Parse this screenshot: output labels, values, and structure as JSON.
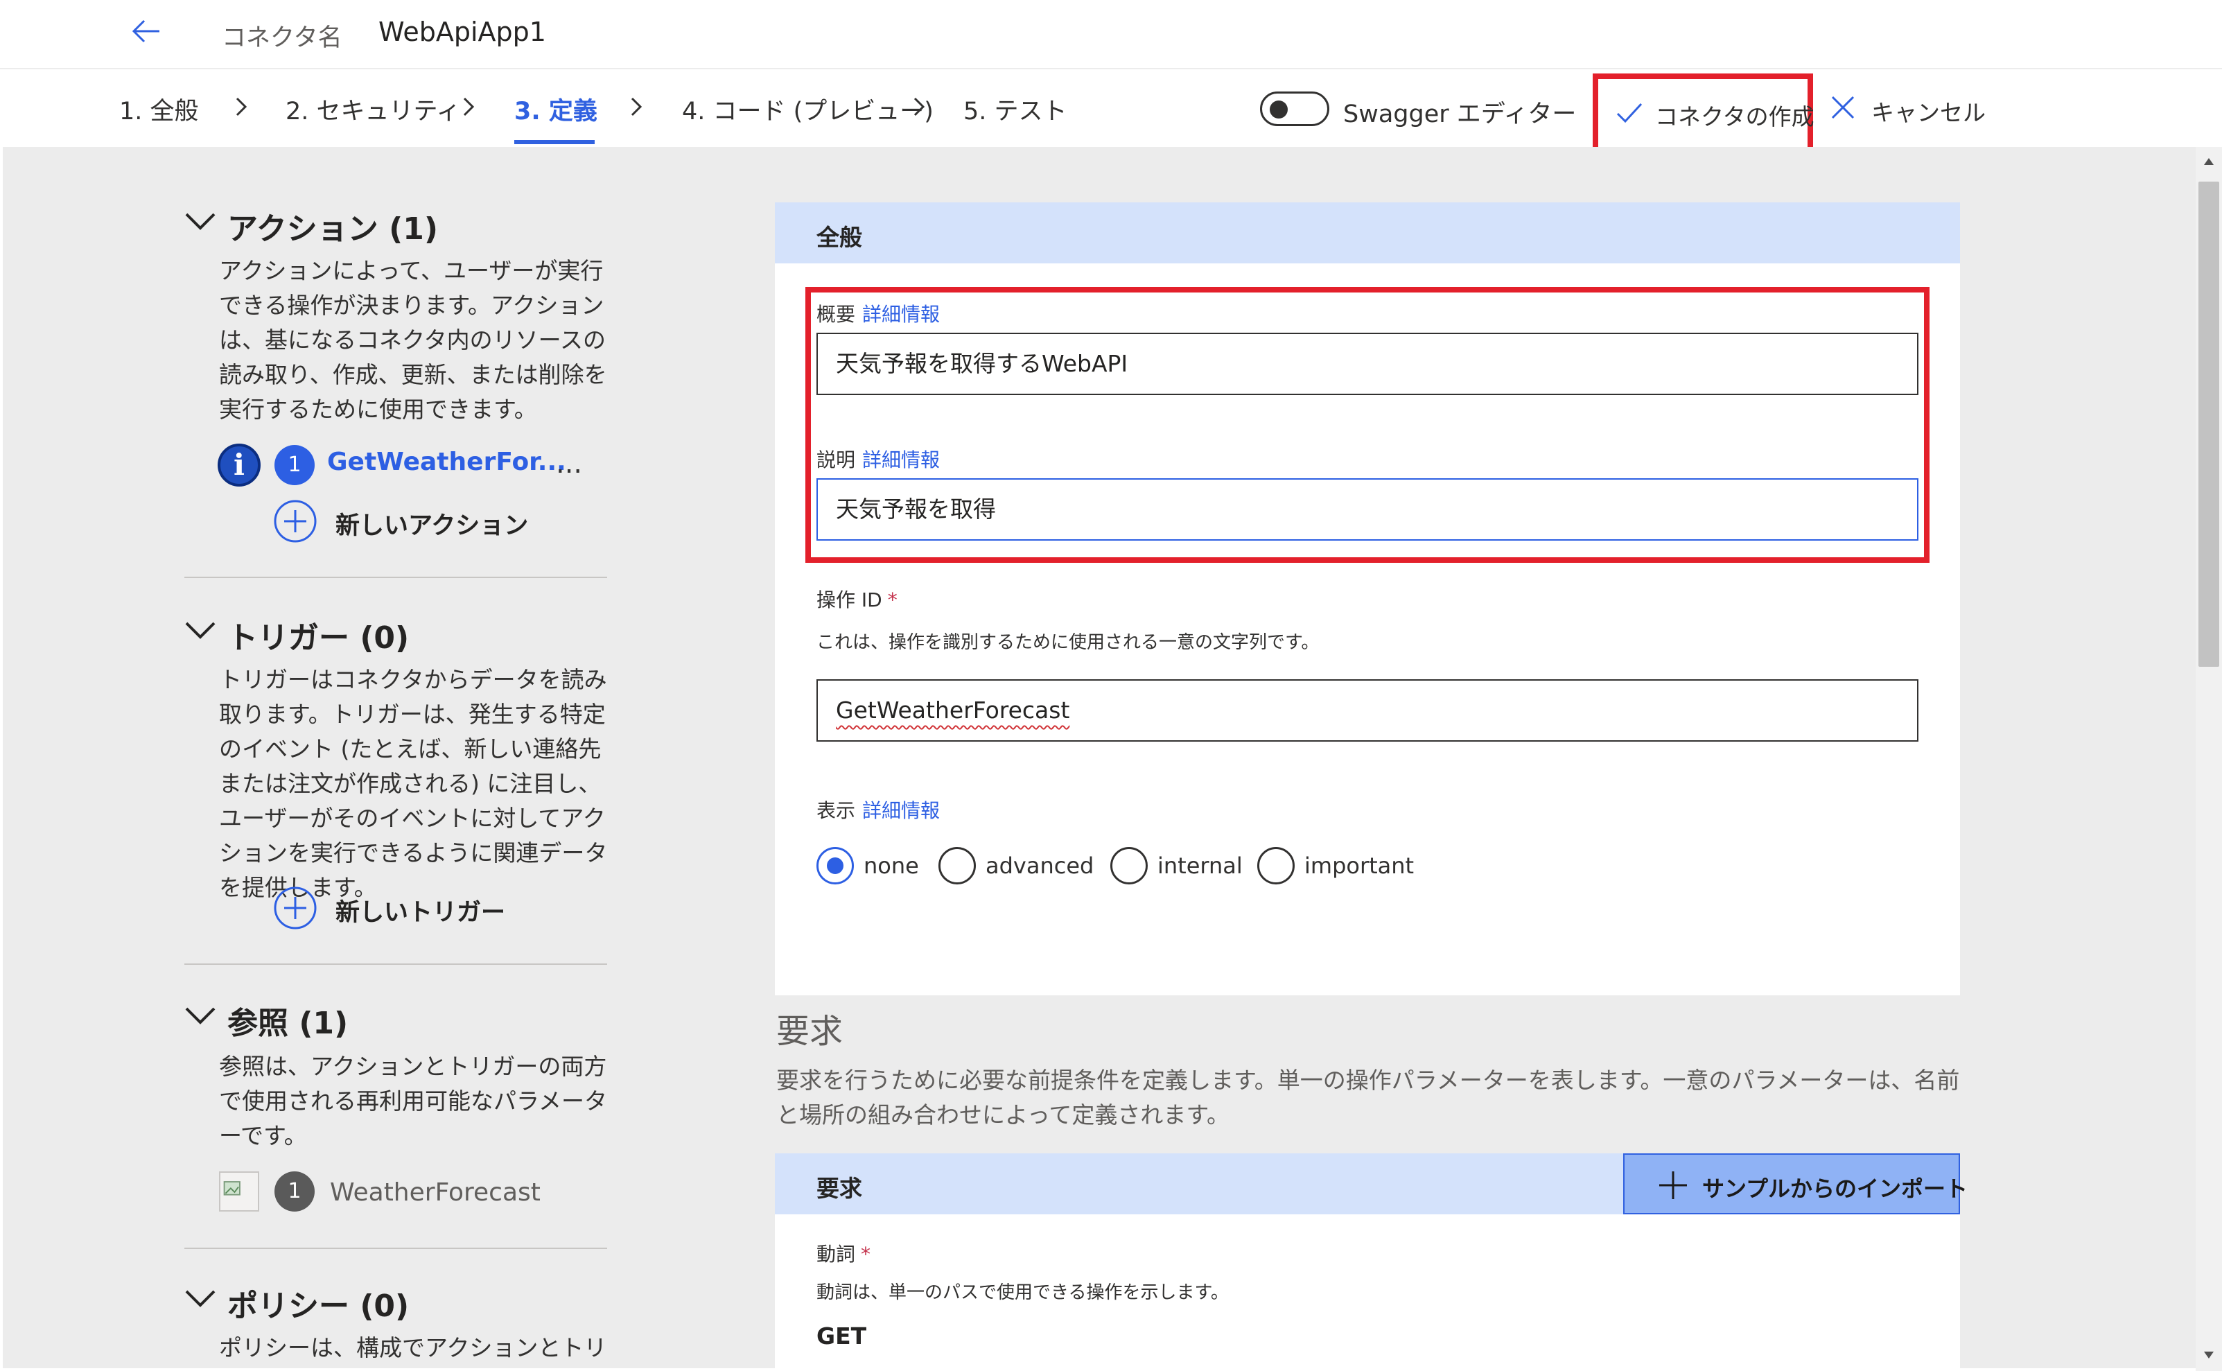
{
  "header": {
    "connector_label": "コネクタ名",
    "connector_name": "WebApiApp1"
  },
  "steps": [
    {
      "label": "1. 全般"
    },
    {
      "label": "2. セキュリティ"
    },
    {
      "label": "3. 定義"
    },
    {
      "label": "4. コード (プレビュー)"
    },
    {
      "label": "5. テスト"
    }
  ],
  "active_step": "3. 定義",
  "toolbar": {
    "swagger_label": "Swagger エディター",
    "swagger_enabled": false,
    "create_label": "コネクタの作成",
    "cancel_label": "キャンセル"
  },
  "sidebar": {
    "actions": {
      "title": "アクション (1)",
      "description": "アクションによって、ユーザーが実行できる操作が決まります。アクションは、基になるコネクタ内のリソースの読み取り、作成、更新、または削除を実行するために使用できます。",
      "item_number": "1",
      "item_label": "GetWeatherFor...",
      "more": "...",
      "add_label": "新しいアクション"
    },
    "triggers": {
      "title": "トリガー (0)",
      "description": "トリガーはコネクタからデータを読み取ります。トリガーは、発生する特定のイベント (たとえば、新しい連絡先または注文が作成される) に注目し、ユーザーがそのイベントに対してアクションを実行できるように関連データを提供します。",
      "add_label": "新しいトリガー"
    },
    "references": {
      "title": "参照 (1)",
      "description": "参照は、アクションとトリガーの両方で使用される再利用可能なパラメーターです。",
      "item_number": "1",
      "item_label": "WeatherForecast"
    },
    "policies": {
      "title": "ポリシー (0)",
      "description": "ポリシーは、構成でアクションとトリガー"
    }
  },
  "general": {
    "title": "全般",
    "summary_label": "概要",
    "summary_link": "詳細情報",
    "summary_value": "天気予報を取得するWebAPI",
    "description_label": "説明",
    "description_link": "詳細情報",
    "description_value": "天気予報を取得",
    "operation_id_label": "操作 ID",
    "required_mark": "*",
    "operation_id_helper": "これは、操作を識別するために使用される一意の文字列です。",
    "operation_id_value": "GetWeatherForecast",
    "visibility_label": "表示",
    "visibility_link": "詳細情報",
    "visibility_options": [
      "none",
      "advanced",
      "internal",
      "important"
    ],
    "visibility_selected": "none"
  },
  "request": {
    "section_title": "要求",
    "section_description": "要求を行うために必要な前提条件を定義します。単一の操作パラメーターを表します。一意のパラメーターは、名前と場所の組み合わせによって定義されます。",
    "card_title": "要求",
    "import_label": "サンプルからのインポート",
    "verb_label": "動詞",
    "required_mark": "*",
    "verb_helper": "動詞は、単一のパスで使用できる操作を示します。",
    "verb_value": "GET"
  },
  "colors": {
    "accent": "#3061e0",
    "highlight_border": "#e3202b",
    "card_header": "#d4e2fb",
    "import_button": "#8fb2f5"
  }
}
